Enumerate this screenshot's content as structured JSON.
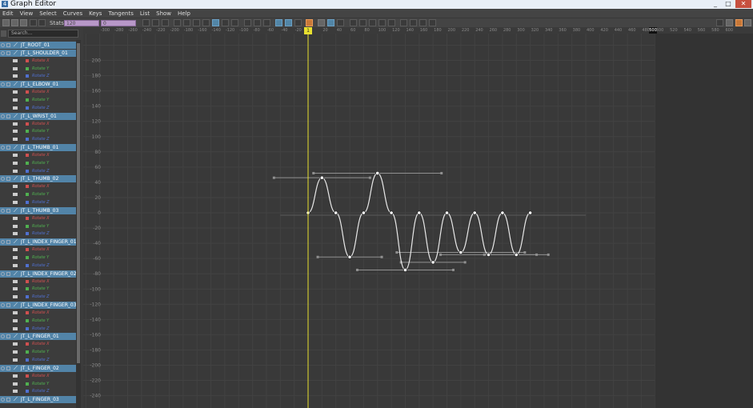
{
  "window": {
    "title": "Graph Editor",
    "icon": "graph-editor-icon",
    "buttons": [
      "_",
      "□",
      "✕"
    ]
  },
  "menu": [
    "Edit",
    "View",
    "Select",
    "Curves",
    "Keys",
    "Tangents",
    "List",
    "Show",
    "Help"
  ],
  "toolbar": {
    "stats_label": "Stats",
    "stats_value_1": "120",
    "stats_value_2": "0"
  },
  "outliner": {
    "search_placeholder": "Search...",
    "rows": [
      {
        "type": "joint",
        "name": "JT_ROOT_01"
      },
      {
        "type": "joint",
        "name": "JT_L_SHOULDER_01"
      },
      {
        "type": "channel",
        "name": "Rotate X",
        "axis": "x"
      },
      {
        "type": "channel",
        "name": "Rotate Y",
        "axis": "y"
      },
      {
        "type": "channel",
        "name": "Rotate Z",
        "axis": "z"
      },
      {
        "type": "joint",
        "name": "JT_L_ELBOW_01"
      },
      {
        "type": "channel",
        "name": "Rotate X",
        "axis": "x"
      },
      {
        "type": "channel",
        "name": "Rotate Y",
        "axis": "y"
      },
      {
        "type": "channel",
        "name": "Rotate Z",
        "axis": "z"
      },
      {
        "type": "joint",
        "name": "JT_L_WRIST_01"
      },
      {
        "type": "channel",
        "name": "Rotate X",
        "axis": "x"
      },
      {
        "type": "channel",
        "name": "Rotate Y",
        "axis": "y"
      },
      {
        "type": "channel",
        "name": "Rotate Z",
        "axis": "z"
      },
      {
        "type": "joint",
        "name": "JT_L_THUMB_01"
      },
      {
        "type": "channel",
        "name": "Rotate X",
        "axis": "x"
      },
      {
        "type": "channel",
        "name": "Rotate Y",
        "axis": "y"
      },
      {
        "type": "channel",
        "name": "Rotate Z",
        "axis": "z"
      },
      {
        "type": "joint",
        "name": "JT_L_THUMB_02"
      },
      {
        "type": "channel",
        "name": "Rotate X",
        "axis": "x"
      },
      {
        "type": "channel",
        "name": "Rotate Y",
        "axis": "y"
      },
      {
        "type": "channel",
        "name": "Rotate Z",
        "axis": "z"
      },
      {
        "type": "joint",
        "name": "JT_L_THUMB_03"
      },
      {
        "type": "channel",
        "name": "Rotate X",
        "axis": "x"
      },
      {
        "type": "channel",
        "name": "Rotate Y",
        "axis": "y"
      },
      {
        "type": "channel",
        "name": "Rotate Z",
        "axis": "z"
      },
      {
        "type": "joint",
        "name": "JT_L_INDEX_FINGER_01"
      },
      {
        "type": "channel",
        "name": "Rotate X",
        "axis": "x"
      },
      {
        "type": "channel",
        "name": "Rotate Y",
        "axis": "y"
      },
      {
        "type": "channel",
        "name": "Rotate Z",
        "axis": "z"
      },
      {
        "type": "joint",
        "name": "JT_L_INDEX_FINGER_02"
      },
      {
        "type": "channel",
        "name": "Rotate X",
        "axis": "x"
      },
      {
        "type": "channel",
        "name": "Rotate Y",
        "axis": "y"
      },
      {
        "type": "channel",
        "name": "Rotate Z",
        "axis": "z"
      },
      {
        "type": "joint",
        "name": "JT_L_INDEX_FINGER_03"
      },
      {
        "type": "channel",
        "name": "Rotate X",
        "axis": "x"
      },
      {
        "type": "channel",
        "name": "Rotate Y",
        "axis": "y"
      },
      {
        "type": "channel",
        "name": "Rotate Z",
        "axis": "z"
      },
      {
        "type": "joint",
        "name": "JT_L_FINGER_01"
      },
      {
        "type": "channel",
        "name": "Rotate X",
        "axis": "x"
      },
      {
        "type": "channel",
        "name": "Rotate Y",
        "axis": "y"
      },
      {
        "type": "channel",
        "name": "Rotate Z",
        "axis": "z"
      },
      {
        "type": "joint",
        "name": "JT_L_FINGER_02"
      },
      {
        "type": "channel",
        "name": "Rotate X",
        "axis": "x"
      },
      {
        "type": "channel",
        "name": "Rotate Y",
        "axis": "y"
      },
      {
        "type": "channel",
        "name": "Rotate Z",
        "axis": "z"
      },
      {
        "type": "joint",
        "name": "JT_L_FINGER_03"
      }
    ],
    "axis_colors": {
      "x": "#d05050",
      "y": "#50b050",
      "z": "#5070d0"
    }
  },
  "timeline": {
    "ticks": [
      "-300",
      "-280",
      "-260",
      "-240",
      "-220",
      "-200",
      "-180",
      "-160",
      "-140",
      "-120",
      "-100",
      "-80",
      "-60",
      "-40",
      "-20",
      "0",
      "20",
      "40",
      "60",
      "80",
      "100",
      "120",
      "140",
      "160",
      "180",
      "200",
      "220",
      "240",
      "260",
      "280",
      "300",
      "320",
      "340",
      "360",
      "380",
      "400",
      "420",
      "440",
      "460",
      "480",
      "500",
      "520",
      "540",
      "560",
      "580",
      "600"
    ],
    "current_frame": "1",
    "range_end": "500",
    "colors": {
      "playhead": "#e8e030",
      "curve": "#e8e8e8",
      "tangent": "#909090"
    }
  },
  "graph": {
    "y_labels": [
      "200",
      "180",
      "160",
      "140",
      "120",
      "100",
      "80",
      "60",
      "40",
      "20",
      "0",
      "-20",
      "-40",
      "-60",
      "-80",
      "-100",
      "-120",
      "-140",
      "-160",
      "-180",
      "-200",
      "-220",
      "-240"
    ]
  },
  "chart_data": {
    "type": "line",
    "series": [
      {
        "x": [
          0,
          20,
          40,
          60,
          80,
          100,
          120,
          140,
          160,
          180,
          200,
          220,
          240,
          260,
          280,
          300,
          320
        ],
        "values": [
          0,
          46,
          0,
          -58,
          0,
          52,
          0,
          -75,
          0,
          -65,
          0,
          -52,
          0,
          -55,
          0,
          -55,
          0
        ]
      }
    ],
    "ylim": [
      -250,
      210
    ],
    "xlim": [
      -320,
      520
    ]
  }
}
